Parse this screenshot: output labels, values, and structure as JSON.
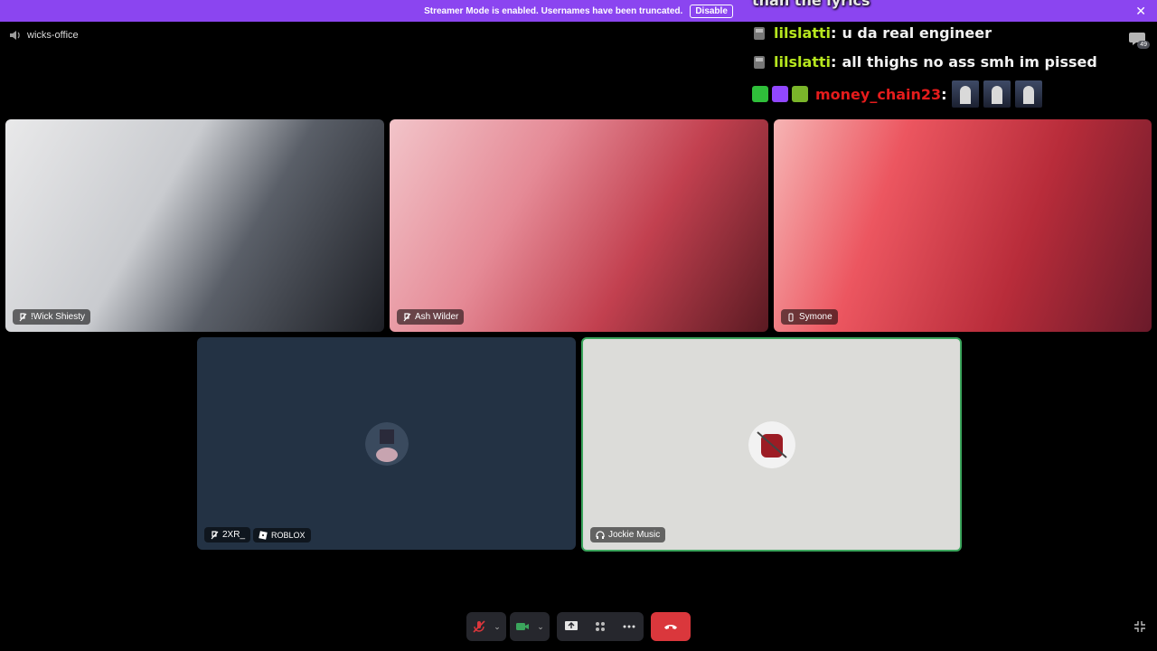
{
  "banner": {
    "text": "Streamer Mode is enabled. Usernames have been truncated.",
    "button": "Disable"
  },
  "channel": {
    "name": "wicks-office"
  },
  "chat": {
    "partial_line": "than the lyrics",
    "messages": [
      {
        "user": "lilslatti",
        "text": "u da real engineer"
      },
      {
        "user": "lilslatti",
        "text": "all thighs no ass smh im pissed"
      },
      {
        "user": "money_chain23",
        "text": ""
      }
    ]
  },
  "chat_count": "49",
  "tiles": [
    {
      "name": "!Wick Shiesty"
    },
    {
      "name": "Ash Wilder"
    },
    {
      "name": "Symone"
    },
    {
      "name": "2XR_",
      "activity": "ROBLOX"
    },
    {
      "name": "Jockie Music"
    }
  ],
  "colors": {
    "banner": "#8b45f0",
    "hangup": "#da373c",
    "speaking_border": "#3ba55c",
    "chat_user_green": "#b6e61e",
    "chat_user_red": "#e51c1c"
  }
}
